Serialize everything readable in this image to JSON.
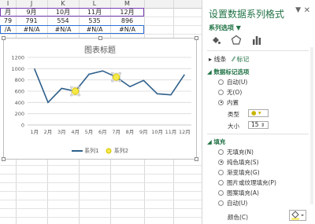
{
  "sheet": {
    "columns": [
      "J",
      "K",
      "L",
      "M"
    ],
    "row1": [
      "9月",
      "10月",
      "11月",
      "12月"
    ],
    "row2": [
      "791",
      "554",
      "535",
      "896"
    ],
    "row3": [
      "#N/A",
      "#N/A",
      "#N/A",
      "#N/A"
    ],
    "left_partial": {
      "col": "I",
      "r1": "月",
      "r2": "79",
      "r3": "/A"
    }
  },
  "chart_data": {
    "type": "line",
    "title": "图表标题",
    "categories": [
      "1月",
      "2月",
      "3月",
      "4月",
      "5月",
      "6月",
      "7月",
      "8月",
      "9月",
      "10月",
      "11月",
      "12月"
    ],
    "series": [
      {
        "name": "系列1",
        "values": [
          1000,
          400,
          650,
          600,
          900,
          960,
          850,
          680,
          791,
          554,
          535,
          896
        ],
        "color": "#2e5f8a"
      },
      {
        "name": "系列2",
        "values": [
          null,
          null,
          null,
          600,
          null,
          null,
          850,
          null,
          null,
          null,
          null,
          null
        ],
        "color": "#f5e94a",
        "marker_outline": "#d6c200"
      }
    ],
    "ylim": [
      0,
      1200
    ],
    "yticks": [
      0,
      200,
      400,
      600,
      800,
      1000,
      1200
    ],
    "grid": true,
    "legend": "bottom"
  },
  "pane": {
    "title": "设置数据系列格式",
    "subtitle": "系列选项 ▼",
    "tabs": [
      "线条",
      "标记"
    ],
    "section_marker_options": "数据标记选项",
    "marker_opts": [
      "自动(U)",
      "无(O)",
      "内置"
    ],
    "type_label": "类型",
    "type_value": "●",
    "size_label": "大小",
    "size_value": "15",
    "section_fill": "填充",
    "fill_opts": [
      "无填充(N)",
      "纯色填充(S)",
      "渐变填充(G)",
      "图片或纹理填充(P)",
      "图案填充(A)",
      "自动(U)"
    ],
    "color_label": "颜色(C)",
    "color_value": "#f5e94a"
  }
}
